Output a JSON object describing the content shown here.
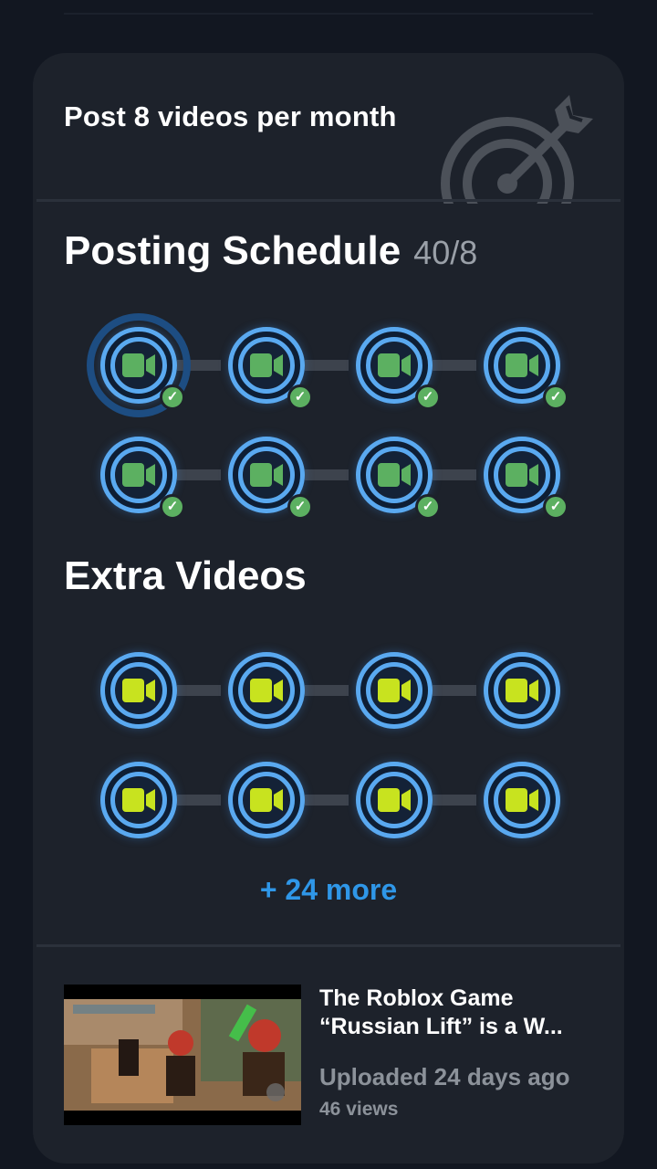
{
  "goal": {
    "title": "Post 8 videos per month",
    "icon": "target-icon"
  },
  "schedule": {
    "title": "Posting Schedule",
    "count": "40/8",
    "node_color": "#5aa9f0",
    "camera_color": "#5cb061",
    "completed": 8
  },
  "extra": {
    "title": "Extra Videos",
    "camera_color": "#c8e31f",
    "shown": 8,
    "more_label": "+ 24 more"
  },
  "latest_video": {
    "title": "The Roblox Game “Russian Lift” is a W...",
    "uploaded": "Uploaded 24 days ago",
    "views": "46 views"
  }
}
